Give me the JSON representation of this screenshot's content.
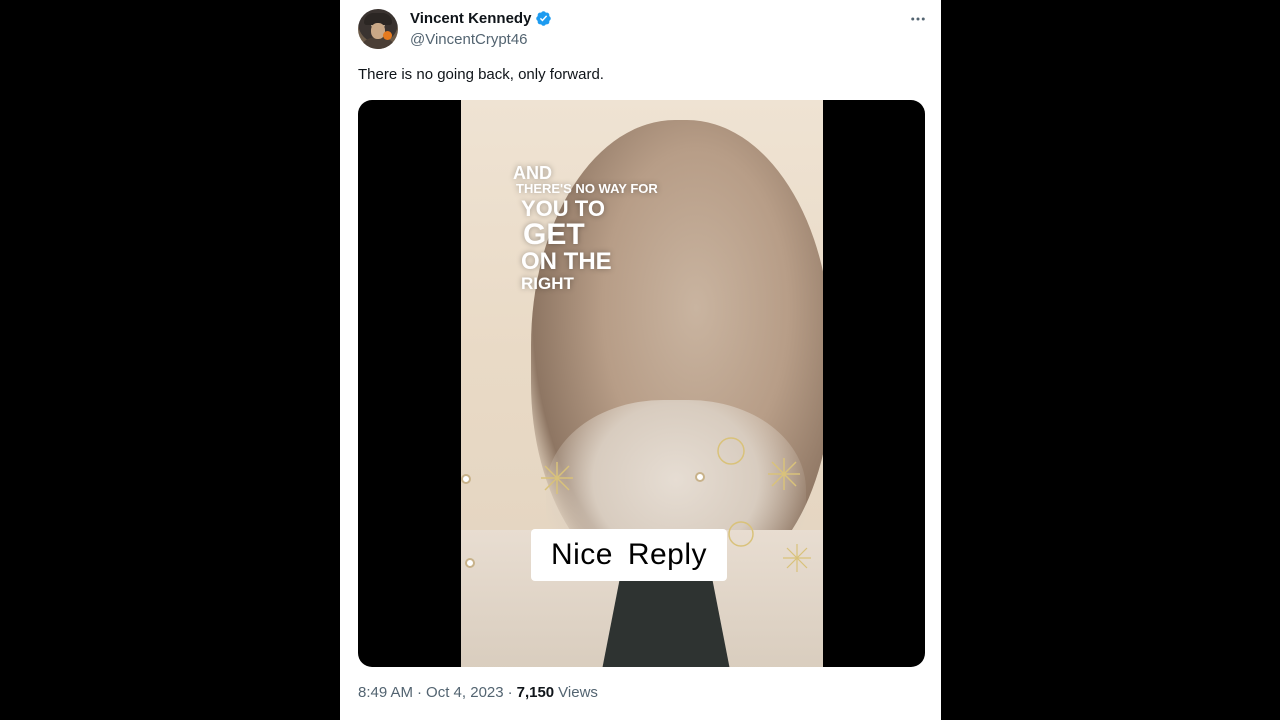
{
  "tweet": {
    "author_name": "Vincent Kennedy",
    "author_handle": "@VincentCrypt46",
    "text": "There is no going back, only forward.",
    "more_icon": "more-horizontal-icon",
    "verified_icon": "verified-badge-icon",
    "media": {
      "overlay_lines": [
        "AND",
        "THERE'S NO WAY FOR",
        "YOU TO",
        "GET",
        "ON THE",
        "RIGHT"
      ],
      "badge_text": "Nice  Reply"
    },
    "time": "8:49 AM",
    "sep1": "·",
    "date": "Oct 4, 2023",
    "sep2": "·",
    "views_count": "7,150",
    "views_label": "Views"
  },
  "colors": {
    "verified": "#1d9bf0",
    "secondary_text": "#536471",
    "primary_text": "#0f1419"
  }
}
